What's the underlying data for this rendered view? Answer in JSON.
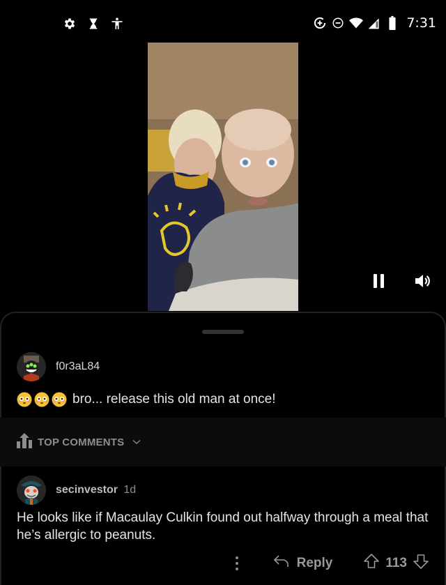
{
  "status_bar": {
    "left_icons": [
      "settings-gear-icon",
      "hourglass-icon",
      "accessibility-icon"
    ],
    "right_icons": [
      "data-saver-icon",
      "do-not-disturb-icon",
      "wifi-icon",
      "cellular-signal-icon",
      "battery-icon"
    ],
    "time": "7:31"
  },
  "video": {
    "controls": [
      "pause-icon",
      "volume-icon"
    ]
  },
  "post": {
    "author": "f0r3aL84",
    "emojis": [
      "flushed-face",
      "flushed-face",
      "flushed-face"
    ],
    "body": "bro... release this old man at once!"
  },
  "sort": {
    "label": "TOP COMMENTS"
  },
  "comments": [
    {
      "author": "secinvestor",
      "time": "1d",
      "body": "He looks like if Macaulay Culkin found out halfway through a meal that he’s allergic to peanuts.",
      "reply_label": "Reply",
      "score": "113"
    }
  ],
  "colors": {
    "background": "#000000",
    "sort_bar": "#0c0c0c",
    "muted_text": "#8d8d8d",
    "body_text": "#e4e4e4"
  }
}
